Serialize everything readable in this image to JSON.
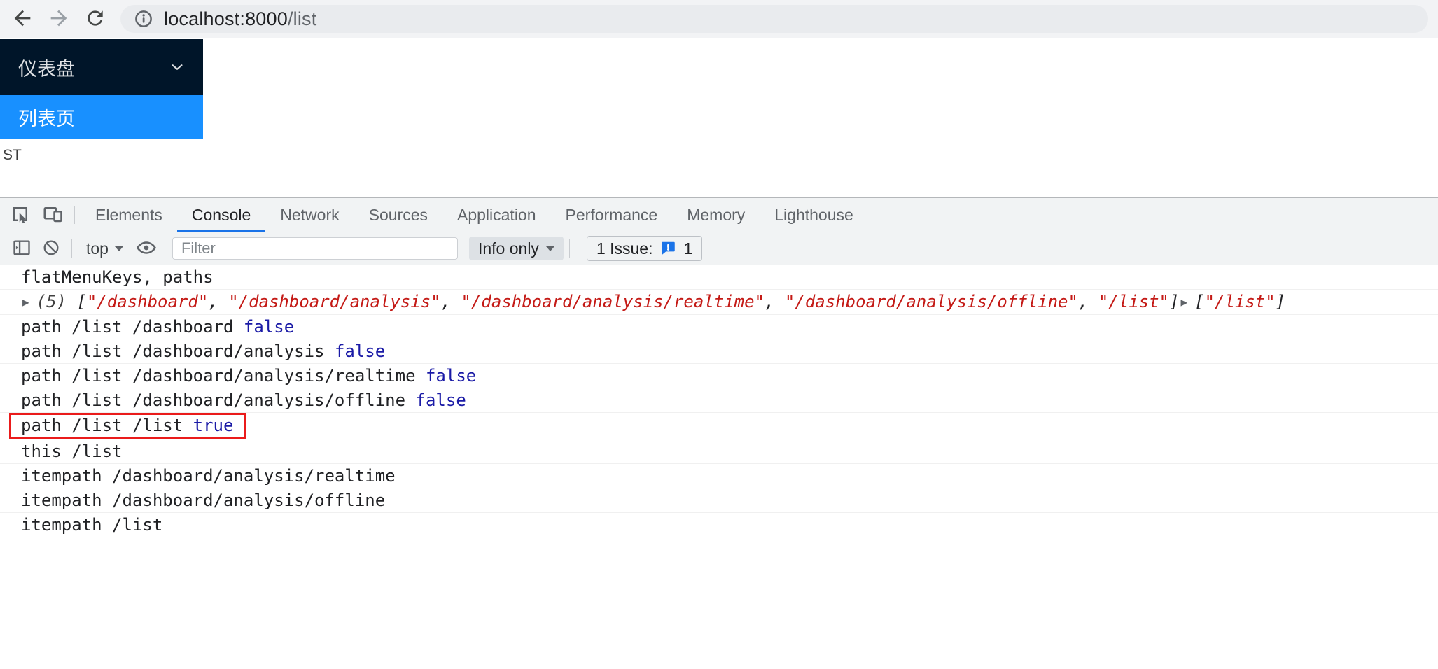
{
  "colors": {
    "menu_bg": "#001529",
    "menu_selected_bg": "#1890ff",
    "devtools_accent": "#1a73e8",
    "boolean_text": "#1a1aa6",
    "string_text": "#c41a16",
    "annotation_box": "#ea1b1b"
  },
  "browser": {
    "url_host": "localhost:8000",
    "url_path": "/list"
  },
  "page": {
    "menu": {
      "submenu_label": "仪表盘",
      "selected_item": "列表页"
    },
    "content_text": "ST"
  },
  "devtools": {
    "tabs": [
      {
        "label": "Elements"
      },
      {
        "label": "Console"
      },
      {
        "label": "Network"
      },
      {
        "label": "Sources"
      },
      {
        "label": "Application"
      },
      {
        "label": "Performance"
      },
      {
        "label": "Memory"
      },
      {
        "label": "Lighthouse"
      }
    ],
    "toolbar": {
      "context": "top",
      "filter_placeholder": "Filter",
      "levels": "Info only",
      "issues_label": "1 Issue:",
      "issues_count": "1"
    },
    "console": {
      "messages": [
        {
          "segments": [
            {
              "style": "plain",
              "text": "flatMenuKeys, paths"
            }
          ]
        },
        {
          "expandable": true,
          "segments": [
            {
              "style": "arrow",
              "text": "▶"
            },
            {
              "style": "count",
              "text": "(5) "
            },
            {
              "style": "punct",
              "text": "["
            },
            {
              "style": "string",
              "text": "\"/dashboard\""
            },
            {
              "style": "punct",
              "text": ", "
            },
            {
              "style": "string",
              "text": "\"/dashboard/analysis\""
            },
            {
              "style": "punct",
              "text": ", "
            },
            {
              "style": "string",
              "text": "\"/dashboard/analysis/realtime\""
            },
            {
              "style": "punct",
              "text": ", "
            },
            {
              "style": "string",
              "text": "\"/dashboard/analysis/offline\""
            },
            {
              "style": "punct",
              "text": ", "
            },
            {
              "style": "string",
              "text": "\"/list\""
            },
            {
              "style": "punct",
              "text": "]"
            },
            {
              "style": "arrow",
              "text": "▶"
            },
            {
              "style": "punct",
              "text": "["
            },
            {
              "style": "string",
              "text": "\"/list\""
            },
            {
              "style": "punct",
              "text": "]"
            }
          ]
        },
        {
          "segments": [
            {
              "style": "plain",
              "text": "path /list /dashboard "
            },
            {
              "style": "boolean",
              "text": "false"
            }
          ]
        },
        {
          "segments": [
            {
              "style": "plain",
              "text": "path /list /dashboard/analysis "
            },
            {
              "style": "boolean",
              "text": "false"
            }
          ]
        },
        {
          "segments": [
            {
              "style": "plain",
              "text": "path /list /dashboard/analysis/realtime "
            },
            {
              "style": "boolean",
              "text": "false"
            }
          ]
        },
        {
          "segments": [
            {
              "style": "plain",
              "text": "path /list /dashboard/analysis/offline "
            },
            {
              "style": "boolean",
              "text": "false"
            }
          ]
        },
        {
          "boxed": true,
          "segments": [
            {
              "style": "plain",
              "text": "path /list /list "
            },
            {
              "style": "boolean",
              "text": "true"
            }
          ]
        },
        {
          "segments": [
            {
              "style": "plain",
              "text": "this /list"
            }
          ]
        },
        {
          "segments": [
            {
              "style": "plain",
              "text": "itempath /dashboard/analysis/realtime"
            }
          ]
        },
        {
          "segments": [
            {
              "style": "plain",
              "text": "itempath /dashboard/analysis/offline"
            }
          ]
        },
        {
          "segments": [
            {
              "style": "plain",
              "text": "itempath /list"
            }
          ]
        }
      ]
    }
  }
}
